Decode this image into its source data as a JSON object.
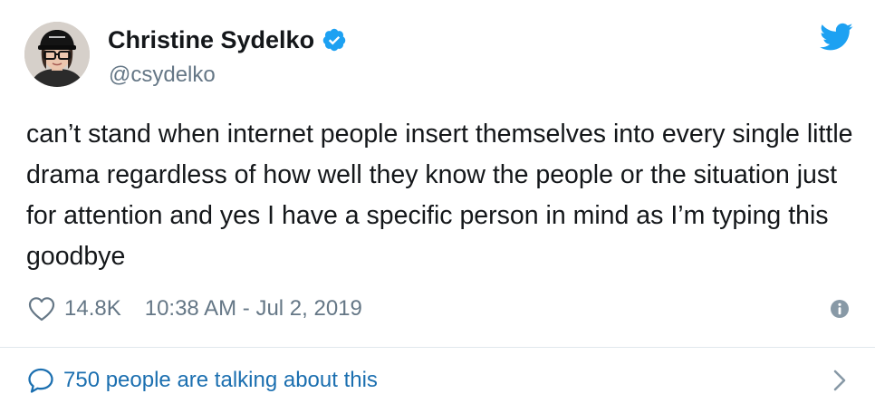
{
  "author": {
    "display_name": "Christine Sydelko",
    "handle": "@csydelko",
    "verified": true
  },
  "tweet": {
    "text": "can’t stand when internet people insert themselves into every single little drama regardless of how well they know the people or the situation just for attention and yes I have a specific person in mind as I’m typing this goodbye"
  },
  "meta": {
    "likes": "14.8K",
    "timestamp": "10:38 AM - Jul 2, 2019"
  },
  "conversation": {
    "label": "750 people are talking about this"
  },
  "icons": {
    "verified": "verified-badge-icon",
    "brand": "twitter-bird-icon",
    "like": "heart-icon",
    "info": "info-icon",
    "conversation": "speech-bubble-icon",
    "expand": "chevron-right-icon"
  },
  "colors": {
    "brand_blue": "#1da1f2",
    "link_blue": "#1b6fb0",
    "text_primary": "#14171a",
    "text_secondary": "#657786",
    "divider": "#e1e8ed"
  }
}
